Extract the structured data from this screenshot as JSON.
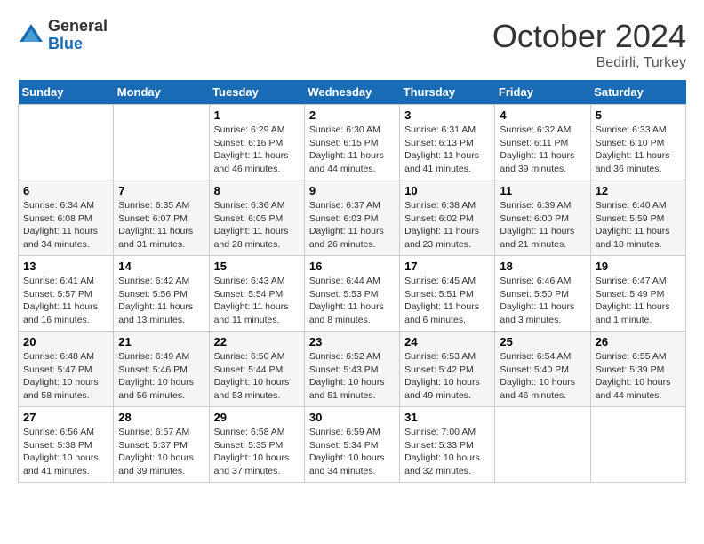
{
  "logo": {
    "general": "General",
    "blue": "Blue"
  },
  "header": {
    "month": "October 2024",
    "location": "Bedirli, Turkey"
  },
  "weekdays": [
    "Sunday",
    "Monday",
    "Tuesday",
    "Wednesday",
    "Thursday",
    "Friday",
    "Saturday"
  ],
  "weeks": [
    [
      {
        "day": null,
        "info": null
      },
      {
        "day": null,
        "info": null
      },
      {
        "day": "1",
        "sunrise": "6:29 AM",
        "sunset": "6:16 PM",
        "daylight": "11 hours and 46 minutes."
      },
      {
        "day": "2",
        "sunrise": "6:30 AM",
        "sunset": "6:15 PM",
        "daylight": "11 hours and 44 minutes."
      },
      {
        "day": "3",
        "sunrise": "6:31 AM",
        "sunset": "6:13 PM",
        "daylight": "11 hours and 41 minutes."
      },
      {
        "day": "4",
        "sunrise": "6:32 AM",
        "sunset": "6:11 PM",
        "daylight": "11 hours and 39 minutes."
      },
      {
        "day": "5",
        "sunrise": "6:33 AM",
        "sunset": "6:10 PM",
        "daylight": "11 hours and 36 minutes."
      }
    ],
    [
      {
        "day": "6",
        "sunrise": "6:34 AM",
        "sunset": "6:08 PM",
        "daylight": "11 hours and 34 minutes."
      },
      {
        "day": "7",
        "sunrise": "6:35 AM",
        "sunset": "6:07 PM",
        "daylight": "11 hours and 31 minutes."
      },
      {
        "day": "8",
        "sunrise": "6:36 AM",
        "sunset": "6:05 PM",
        "daylight": "11 hours and 28 minutes."
      },
      {
        "day": "9",
        "sunrise": "6:37 AM",
        "sunset": "6:03 PM",
        "daylight": "11 hours and 26 minutes."
      },
      {
        "day": "10",
        "sunrise": "6:38 AM",
        "sunset": "6:02 PM",
        "daylight": "11 hours and 23 minutes."
      },
      {
        "day": "11",
        "sunrise": "6:39 AM",
        "sunset": "6:00 PM",
        "daylight": "11 hours and 21 minutes."
      },
      {
        "day": "12",
        "sunrise": "6:40 AM",
        "sunset": "5:59 PM",
        "daylight": "11 hours and 18 minutes."
      }
    ],
    [
      {
        "day": "13",
        "sunrise": "6:41 AM",
        "sunset": "5:57 PM",
        "daylight": "11 hours and 16 minutes."
      },
      {
        "day": "14",
        "sunrise": "6:42 AM",
        "sunset": "5:56 PM",
        "daylight": "11 hours and 13 minutes."
      },
      {
        "day": "15",
        "sunrise": "6:43 AM",
        "sunset": "5:54 PM",
        "daylight": "11 hours and 11 minutes."
      },
      {
        "day": "16",
        "sunrise": "6:44 AM",
        "sunset": "5:53 PM",
        "daylight": "11 hours and 8 minutes."
      },
      {
        "day": "17",
        "sunrise": "6:45 AM",
        "sunset": "5:51 PM",
        "daylight": "11 hours and 6 minutes."
      },
      {
        "day": "18",
        "sunrise": "6:46 AM",
        "sunset": "5:50 PM",
        "daylight": "11 hours and 3 minutes."
      },
      {
        "day": "19",
        "sunrise": "6:47 AM",
        "sunset": "5:49 PM",
        "daylight": "11 hours and 1 minute."
      }
    ],
    [
      {
        "day": "20",
        "sunrise": "6:48 AM",
        "sunset": "5:47 PM",
        "daylight": "10 hours and 58 minutes."
      },
      {
        "day": "21",
        "sunrise": "6:49 AM",
        "sunset": "5:46 PM",
        "daylight": "10 hours and 56 minutes."
      },
      {
        "day": "22",
        "sunrise": "6:50 AM",
        "sunset": "5:44 PM",
        "daylight": "10 hours and 53 minutes."
      },
      {
        "day": "23",
        "sunrise": "6:52 AM",
        "sunset": "5:43 PM",
        "daylight": "10 hours and 51 minutes."
      },
      {
        "day": "24",
        "sunrise": "6:53 AM",
        "sunset": "5:42 PM",
        "daylight": "10 hours and 49 minutes."
      },
      {
        "day": "25",
        "sunrise": "6:54 AM",
        "sunset": "5:40 PM",
        "daylight": "10 hours and 46 minutes."
      },
      {
        "day": "26",
        "sunrise": "6:55 AM",
        "sunset": "5:39 PM",
        "daylight": "10 hours and 44 minutes."
      }
    ],
    [
      {
        "day": "27",
        "sunrise": "6:56 AM",
        "sunset": "5:38 PM",
        "daylight": "10 hours and 41 minutes."
      },
      {
        "day": "28",
        "sunrise": "6:57 AM",
        "sunset": "5:37 PM",
        "daylight": "10 hours and 39 minutes."
      },
      {
        "day": "29",
        "sunrise": "6:58 AM",
        "sunset": "5:35 PM",
        "daylight": "10 hours and 37 minutes."
      },
      {
        "day": "30",
        "sunrise": "6:59 AM",
        "sunset": "5:34 PM",
        "daylight": "10 hours and 34 minutes."
      },
      {
        "day": "31",
        "sunrise": "7:00 AM",
        "sunset": "5:33 PM",
        "daylight": "10 hours and 32 minutes."
      },
      {
        "day": null,
        "info": null
      },
      {
        "day": null,
        "info": null
      }
    ]
  ]
}
